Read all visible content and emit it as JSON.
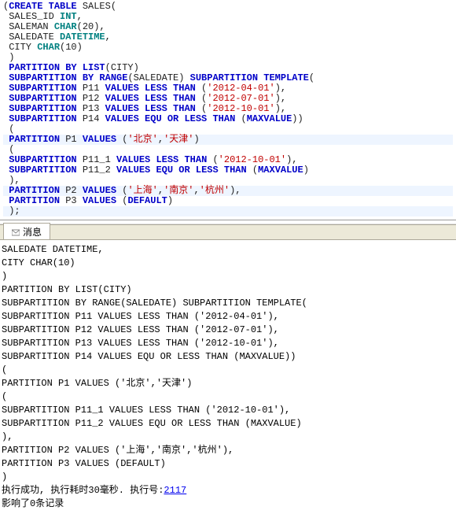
{
  "editor": {
    "lines": [
      {
        "hl": false,
        "tokens": [
          {
            "t": "(",
            "c": "pn"
          },
          {
            "t": "CREATE TABLE",
            "c": "kw"
          },
          {
            "t": " SALES",
            "c": "id"
          },
          {
            "t": "(",
            "c": "pn"
          }
        ]
      },
      {
        "hl": false,
        "tokens": [
          {
            "t": " SALES_ID ",
            "c": "id"
          },
          {
            "t": "INT",
            "c": "ty"
          },
          {
            "t": ",",
            "c": "pn"
          }
        ]
      },
      {
        "hl": false,
        "tokens": [
          {
            "t": " SALEMAN ",
            "c": "id"
          },
          {
            "t": "CHAR",
            "c": "ty"
          },
          {
            "t": "(",
            "c": "pn"
          },
          {
            "t": "20",
            "c": "id"
          },
          {
            "t": ")",
            "c": "pn"
          },
          {
            "t": ",",
            "c": "pn"
          }
        ]
      },
      {
        "hl": false,
        "tokens": [
          {
            "t": " SALEDATE ",
            "c": "id"
          },
          {
            "t": "DATETIME",
            "c": "ty"
          },
          {
            "t": ",",
            "c": "pn"
          }
        ]
      },
      {
        "hl": false,
        "tokens": [
          {
            "t": " CITY ",
            "c": "id"
          },
          {
            "t": "CHAR",
            "c": "ty"
          },
          {
            "t": "(",
            "c": "pn"
          },
          {
            "t": "10",
            "c": "id"
          },
          {
            "t": ")",
            "c": "pn"
          }
        ]
      },
      {
        "hl": false,
        "tokens": [
          {
            "t": " )",
            "c": "pn"
          }
        ]
      },
      {
        "hl": false,
        "tokens": [
          {
            "t": " ",
            "c": "pn"
          },
          {
            "t": "PARTITION BY LIST",
            "c": "kw"
          },
          {
            "t": "(",
            "c": "pn"
          },
          {
            "t": "CITY",
            "c": "id"
          },
          {
            "t": ")",
            "c": "pn"
          }
        ]
      },
      {
        "hl": false,
        "tokens": [
          {
            "t": " ",
            "c": "pn"
          },
          {
            "t": "SUBPARTITION BY RANGE",
            "c": "kw"
          },
          {
            "t": "(",
            "c": "pn"
          },
          {
            "t": "SALEDATE",
            "c": "id"
          },
          {
            "t": ") ",
            "c": "pn"
          },
          {
            "t": "SUBPARTITION TEMPLATE",
            "c": "kw2"
          },
          {
            "t": "(",
            "c": "pn"
          }
        ]
      },
      {
        "hl": false,
        "tokens": [
          {
            "t": " ",
            "c": "pn"
          },
          {
            "t": "SUBPARTITION",
            "c": "kw"
          },
          {
            "t": " P11 ",
            "c": "id"
          },
          {
            "t": "VALUES LESS THAN",
            "c": "kw"
          },
          {
            "t": " (",
            "c": "pn"
          },
          {
            "t": "'2012-04-01'",
            "c": "str"
          },
          {
            "t": ")",
            "c": "pn"
          },
          {
            "t": ",",
            "c": "pn"
          }
        ]
      },
      {
        "hl": false,
        "tokens": [
          {
            "t": " ",
            "c": "pn"
          },
          {
            "t": "SUBPARTITION",
            "c": "kw"
          },
          {
            "t": " P12 ",
            "c": "id"
          },
          {
            "t": "VALUES LESS THAN",
            "c": "kw"
          },
          {
            "t": " (",
            "c": "pn"
          },
          {
            "t": "'2012-07-01'",
            "c": "str"
          },
          {
            "t": ")",
            "c": "pn"
          },
          {
            "t": ",",
            "c": "pn"
          }
        ]
      },
      {
        "hl": false,
        "tokens": [
          {
            "t": " ",
            "c": "pn"
          },
          {
            "t": "SUBPARTITION",
            "c": "kw"
          },
          {
            "t": " P13 ",
            "c": "id"
          },
          {
            "t": "VALUES LESS THAN",
            "c": "kw"
          },
          {
            "t": " (",
            "c": "pn"
          },
          {
            "t": "'2012-10-01'",
            "c": "str"
          },
          {
            "t": ")",
            "c": "pn"
          },
          {
            "t": ",",
            "c": "pn"
          }
        ]
      },
      {
        "hl": false,
        "tokens": [
          {
            "t": " ",
            "c": "pn"
          },
          {
            "t": "SUBPARTITION",
            "c": "kw"
          },
          {
            "t": " P14 ",
            "c": "id"
          },
          {
            "t": "VALUES EQU OR LESS THAN",
            "c": "kw"
          },
          {
            "t": " (",
            "c": "pn"
          },
          {
            "t": "MAXVALUE",
            "c": "kw"
          },
          {
            "t": ")",
            "c": "pn"
          },
          {
            "t": ")",
            "c": "pn"
          }
        ]
      },
      {
        "hl": false,
        "tokens": [
          {
            "t": " (",
            "c": "pn"
          }
        ]
      },
      {
        "hl": true,
        "tokens": [
          {
            "t": " ",
            "c": "pn"
          },
          {
            "t": "PARTITION",
            "c": "kw"
          },
          {
            "t": " P1 ",
            "c": "id"
          },
          {
            "t": "VALUES",
            "c": "kw"
          },
          {
            "t": " (",
            "c": "pn"
          },
          {
            "t": "'北京'",
            "c": "cn"
          },
          {
            "t": ",",
            "c": "pn"
          },
          {
            "t": "'天津'",
            "c": "cn"
          },
          {
            "t": ")",
            "c": "pn"
          }
        ]
      },
      {
        "hl": false,
        "tokens": [
          {
            "t": " (",
            "c": "pn"
          }
        ]
      },
      {
        "hl": false,
        "tokens": [
          {
            "t": " ",
            "c": "pn"
          },
          {
            "t": "SUBPARTITION",
            "c": "kw"
          },
          {
            "t": " P11_1 ",
            "c": "id"
          },
          {
            "t": "VALUES LESS THAN",
            "c": "kw"
          },
          {
            "t": " (",
            "c": "pn"
          },
          {
            "t": "'2012-10-01'",
            "c": "str"
          },
          {
            "t": ")",
            "c": "pn"
          },
          {
            "t": ",",
            "c": "pn"
          }
        ]
      },
      {
        "hl": false,
        "tokens": [
          {
            "t": " ",
            "c": "pn"
          },
          {
            "t": "SUBPARTITION",
            "c": "kw"
          },
          {
            "t": " P11_2 ",
            "c": "id"
          },
          {
            "t": "VALUES EQU OR LESS THAN",
            "c": "kw"
          },
          {
            "t": " (",
            "c": "pn"
          },
          {
            "t": "MAXVALUE",
            "c": "kw"
          },
          {
            "t": ")",
            "c": "pn"
          }
        ]
      },
      {
        "hl": false,
        "tokens": [
          {
            "t": " )",
            "c": "pn"
          },
          {
            "t": ",",
            "c": "pn"
          }
        ]
      },
      {
        "hl": true,
        "tokens": [
          {
            "t": " ",
            "c": "pn"
          },
          {
            "t": "PARTITION",
            "c": "kw"
          },
          {
            "t": " P2 ",
            "c": "id"
          },
          {
            "t": "VALUES",
            "c": "kw"
          },
          {
            "t": " (",
            "c": "pn"
          },
          {
            "t": "'上海'",
            "c": "cn"
          },
          {
            "t": ",",
            "c": "pn"
          },
          {
            "t": "'南京'",
            "c": "cn"
          },
          {
            "t": ",",
            "c": "pn"
          },
          {
            "t": "'杭州'",
            "c": "cn"
          },
          {
            "t": ")",
            "c": "pn"
          },
          {
            "t": ",",
            "c": "pn"
          }
        ]
      },
      {
        "hl": false,
        "tokens": [
          {
            "t": " ",
            "c": "pn"
          },
          {
            "t": "PARTITION",
            "c": "kw"
          },
          {
            "t": " P3 ",
            "c": "id"
          },
          {
            "t": "VALUES",
            "c": "kw"
          },
          {
            "t": " (",
            "c": "pn"
          },
          {
            "t": "DEFAULT",
            "c": "kw"
          },
          {
            "t": ")",
            "c": "pn"
          }
        ]
      },
      {
        "hl": true,
        "tokens": [
          {
            "t": " )",
            "c": "pn"
          },
          {
            "t": ";",
            "c": "pn"
          }
        ]
      }
    ]
  },
  "tab": {
    "label": "消息"
  },
  "output": {
    "lines": [
      "SALEDATE DATETIME,",
      "CITY CHAR(10)",
      ")",
      "PARTITION BY LIST(CITY)",
      "SUBPARTITION BY RANGE(SALEDATE) SUBPARTITION TEMPLATE(",
      "SUBPARTITION P11 VALUES LESS THAN ('2012-04-01'),",
      "SUBPARTITION P12 VALUES LESS THAN ('2012-07-01'),",
      "SUBPARTITION P13 VALUES LESS THAN ('2012-10-01'),",
      "SUBPARTITION P14 VALUES EQU OR LESS THAN (MAXVALUE))",
      "(",
      "PARTITION P1 VALUES ('北京','天津')",
      "(",
      "SUBPARTITION P11_1 VALUES LESS THAN ('2012-10-01'),",
      "SUBPARTITION P11_2 VALUES EQU OR LESS THAN (MAXVALUE)",
      "),",
      "PARTITION P2 VALUES ('上海','南京','杭州'),",
      "PARTITION P3 VALUES (DEFAULT)",
      ")"
    ],
    "status_prefix": "执行成功, 执行耗时30毫秒. 执行号:",
    "run_id": "2117",
    "affected": "影响了0条记录"
  }
}
